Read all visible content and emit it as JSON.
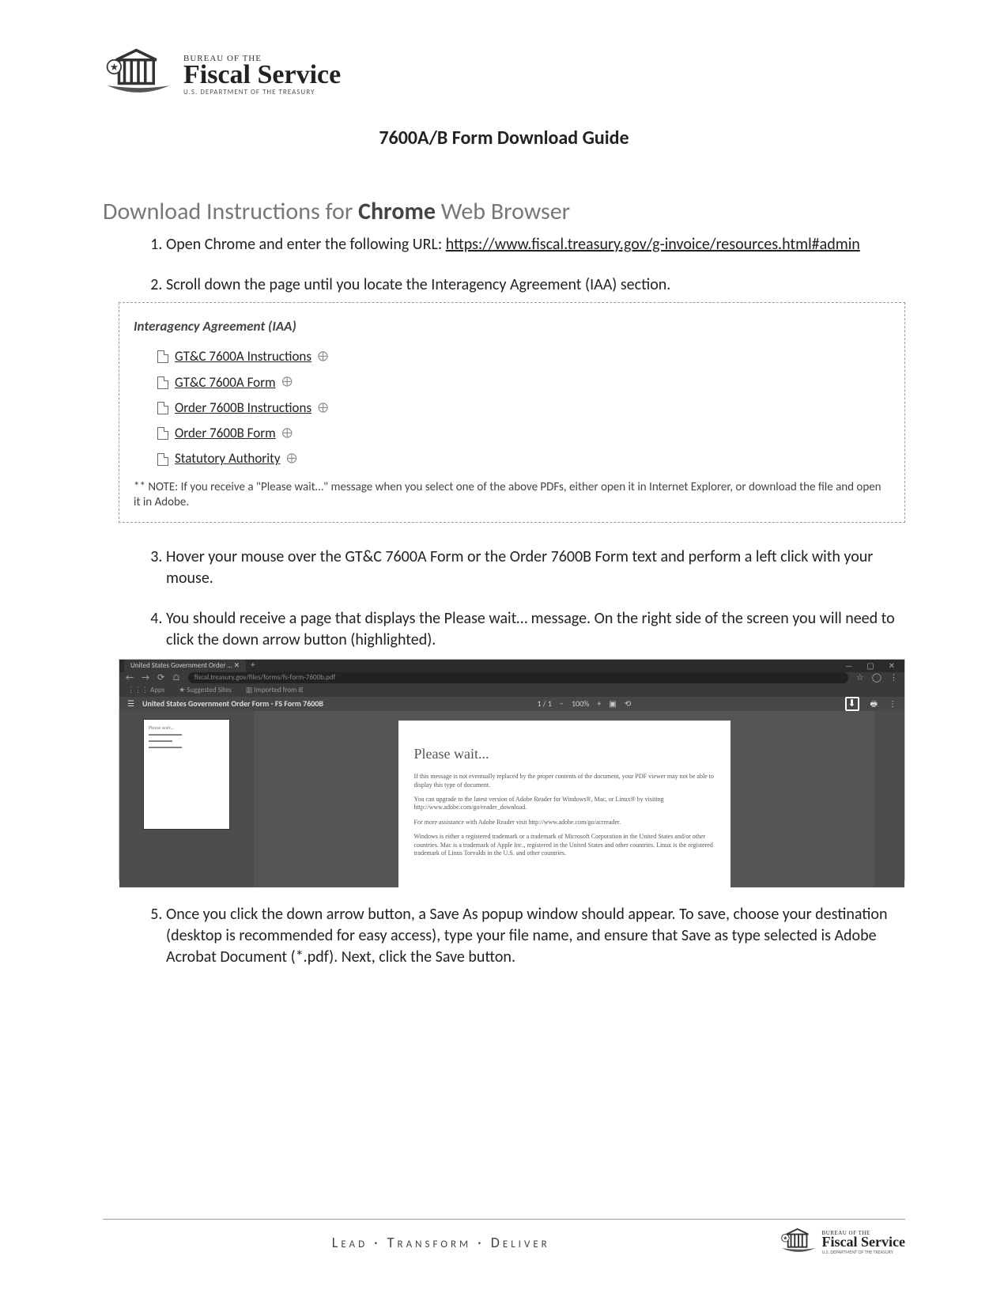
{
  "logo": {
    "top": "BUREAU OF THE",
    "main": "Fiscal Service",
    "sub": "U.S. DEPARTMENT OF THE TREASURY"
  },
  "title": "7600A/B Form Download Guide",
  "section_heading_pre": "Download Instructions for ",
  "section_heading_strong": "Chrome",
  "section_heading_post": " Web Browser",
  "steps": {
    "s1_a": "Open Chrome and enter the following URL: ",
    "s1_link": "https://www.fiscal.treasury.gov/g-invoice/resources.html#admin",
    "s2": "Scroll down the page until you locate the Interagency Agreement (IAA) section.",
    "s3": "Hover your mouse over the GT&C 7600A Form or the Order 7600B Form text and perform a left click with your mouse.",
    "s4": "You should receive a page that displays the Please wait… message. On the right side of the screen you will need to click the down arrow button (highlighted).",
    "s5": "Once you click the down arrow button, a Save As popup window should appear. To save, choose your destination (desktop is recommended for easy access), type your file name, and ensure that Save as type selected is Adobe Acrobat Document (*.pdf). Next, click the Save button."
  },
  "iaa": {
    "title": "Interagency Agreement (IAA)",
    "links": {
      "l1": "GT&C 7600A Instructions",
      "l2": "GT&C 7600A Form",
      "l3": "Order 7600B Instructions",
      "l4": "Order 7600B Form",
      "l5": "Statutory Authority"
    },
    "ext": "⨁",
    "note": "** NOTE: If you receive a \"Please wait…\" message when you select one of the above PDFs, either open it in Internet Explorer, or download the file and open it in Adobe."
  },
  "browser": {
    "tab": "United States Government Order …  ✕",
    "url": "fiscal.treasury.gov/files/forms/fs-form-7600b.pdf",
    "bookmarks": {
      "apps": "Apps",
      "b1": "Suggested Sites",
      "b2": "Imported from IE"
    },
    "pdf_title": "United States Government Order Form - FS Form 7600B",
    "zoom": "100%",
    "page_ind": "1 / 1",
    "pw_heading": "Please wait...",
    "pw_p1": "If this message is not eventually replaced by the proper contents of the document, your PDF viewer may not be able to display this type of document.",
    "pw_p2": "You can upgrade to the latest version of Adobe Reader for Windows®, Mac, or Linux® by visiting http://www.adobe.com/go/reader_download.",
    "pw_p3": "For more assistance with Adobe Reader visit http://www.adobe.com/go/acrreader.",
    "pw_p4": "Windows is either a registered trademark or a trademark of Microsoft Corporation in the United States and/or other countries. Mac is a trademark of Apple Inc., registered in the United States and other countries. Linux is the registered trademark of Linus Torvalds in the U.S. and other countries."
  },
  "footer": {
    "text": "Lead  ·  Transform  ·  Deliver",
    "logo_top": "BUREAU OF THE",
    "logo_main": "Fiscal Service",
    "logo_sub": "U.S. DEPARTMENT OF THE TREASURY"
  }
}
